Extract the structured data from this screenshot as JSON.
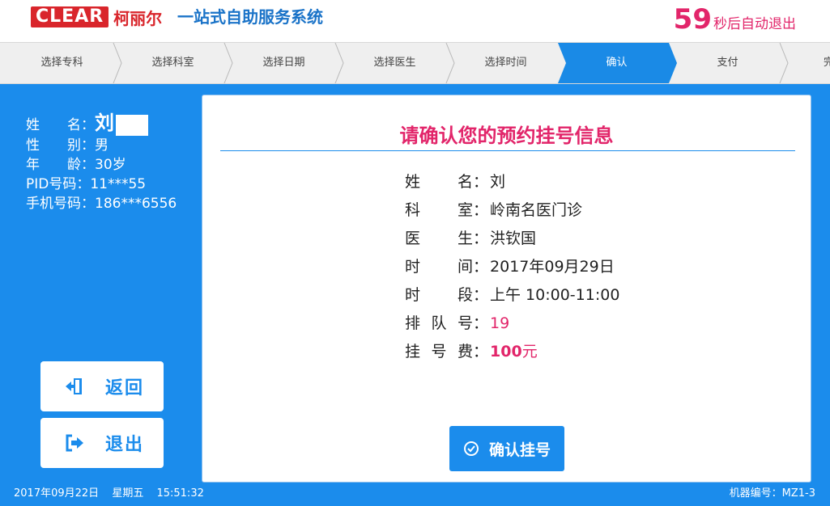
{
  "header": {
    "logo_text": "CLEAR",
    "logo_cn": "柯丽尔",
    "title": "一站式自助服务系统",
    "countdown_num": "59",
    "countdown_text": "秒后自动退出"
  },
  "steps": [
    {
      "label": "选择专科",
      "active": false
    },
    {
      "label": "选择科室",
      "active": false
    },
    {
      "label": "选择日期",
      "active": false
    },
    {
      "label": "选择医生",
      "active": false
    },
    {
      "label": "选择时间",
      "active": false
    },
    {
      "label": "确认",
      "active": true
    },
    {
      "label": "支付",
      "active": false
    },
    {
      "label": "完",
      "active": false
    }
  ],
  "user": {
    "name_label": "姓　　名：",
    "name_value": "刘",
    "gender_label": "性　　别：",
    "gender_value": "男",
    "age_label": "年　　龄：",
    "age_value": "30岁",
    "pid_label": "PID号码：",
    "pid_value": "11***55",
    "phone_label": "手机号码：",
    "phone_value": "186***6556"
  },
  "buttons": {
    "back": "返回",
    "exit": "退出",
    "confirm": "确认挂号"
  },
  "card": {
    "title": "请确认您的预约挂号信息",
    "rows": [
      {
        "key": "姓名",
        "value": "刘"
      },
      {
        "key": "科室",
        "value": "岭南名医门诊"
      },
      {
        "key": "医生",
        "value": "洪钦国"
      },
      {
        "key": "时间",
        "value": "2017年09月29日"
      },
      {
        "key": "时段",
        "value": "上午 10:00-11:00"
      },
      {
        "key": "排队号",
        "value": "19"
      },
      {
        "key": "挂号费",
        "value": "100",
        "unit": "元"
      }
    ]
  },
  "footer": {
    "date": "2017年09月22日",
    "weekday": "星期五",
    "time": "15:51:32",
    "machine": "机器编号：MZ1-3"
  },
  "colors": {
    "primary_blue": "#1b8cec",
    "accent_pink": "#e2256a",
    "logo_red": "#d9252b"
  }
}
